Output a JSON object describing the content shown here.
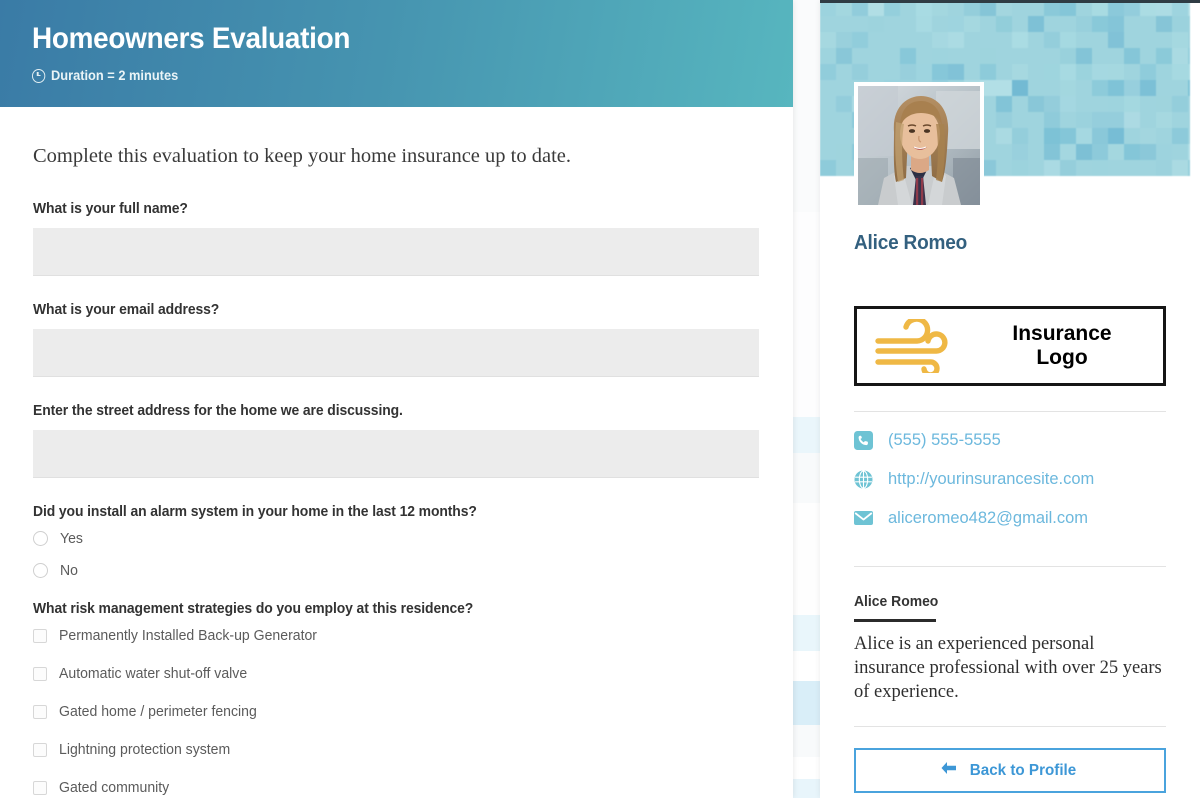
{
  "form": {
    "title": "Homeowners Evaluation",
    "duration": "Duration = 2 minutes",
    "intro": "Complete this evaluation to keep your home insurance up to date.",
    "fields": [
      {
        "label": "What is your full name?",
        "value": "",
        "placeholder": ""
      },
      {
        "label": "What is your email address?",
        "value": "",
        "placeholder": ""
      },
      {
        "label": "Enter the street address for the home we are discussing.",
        "value": "",
        "placeholder": ""
      }
    ],
    "radio_question": {
      "label": "Did you install an alarm system in your home in the last 12 months?",
      "options": [
        "Yes",
        "No"
      ],
      "selected": ""
    },
    "checkbox_question": {
      "label": "What risk management strategies do you employ at this residence?",
      "options": [
        "Permanently Installed Back-up Generator",
        "Automatic water shut-off valve",
        "Gated home / perimeter fencing",
        "Lightning protection system",
        "Gated community"
      ],
      "selected": []
    }
  },
  "sidebar": {
    "agent_name": "Alice Romeo",
    "logo_text_line1": "Insurance",
    "logo_text_line2": "Logo",
    "contacts": [
      {
        "icon": "phone-icon",
        "text": "(555) 555-5555"
      },
      {
        "icon": "globe-icon",
        "text": "http://yourinsurancesite.com"
      },
      {
        "icon": "envelope-icon",
        "text": "aliceromeo482@gmail.com"
      }
    ],
    "bio_name": "Alice Romeo",
    "bio_text": "Alice is an experienced personal insurance professional with over 25 years of experience.",
    "back_button": "Back to Profile"
  },
  "colors": {
    "header_gradient_start": "#3a7ba6",
    "header_gradient_end": "#57b6bf",
    "banner_mosaic": "#9fd4de",
    "agent_name": "#33607f",
    "link": "#6cb8dd",
    "contact_icon": "#6ec3d4",
    "logo_mark": "#efb845",
    "button_border": "#4aa3dd",
    "button_text": "#3d97d6",
    "input_bg": "#ececec"
  }
}
